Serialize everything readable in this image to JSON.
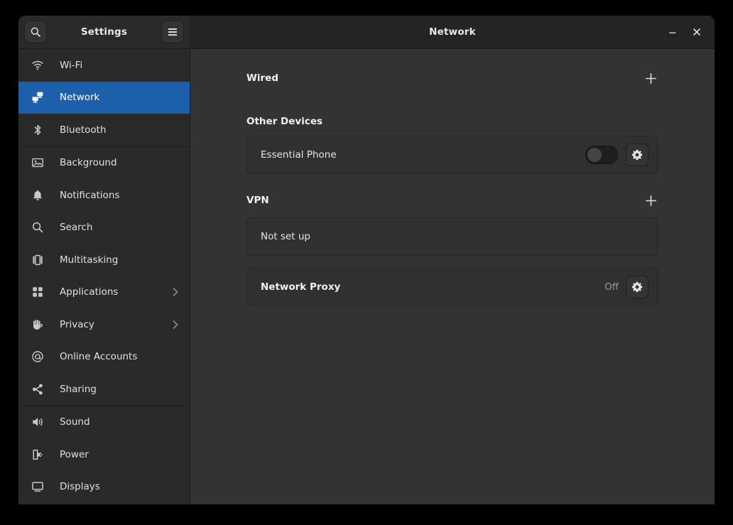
{
  "window": {
    "title": "Network",
    "minimize_label": "–",
    "close_label": "✕"
  },
  "sidebar_header": {
    "title": "Settings",
    "search_icon": "search-icon",
    "menu_icon": "hamburger-menu-icon"
  },
  "sidebar": {
    "items": [
      {
        "label": "Wi-Fi",
        "icon": "wifi-icon",
        "selected": false,
        "chevron": false
      },
      {
        "label": "Network",
        "icon": "network-icon",
        "selected": true,
        "chevron": false
      },
      {
        "label": "Bluetooth",
        "icon": "bluetooth-icon",
        "selected": false,
        "chevron": false
      },
      {
        "label": "Background",
        "icon": "background-image-icon",
        "selected": false,
        "chevron": false
      },
      {
        "label": "Notifications",
        "icon": "bell-icon",
        "selected": false,
        "chevron": false
      },
      {
        "label": "Search",
        "icon": "search-icon",
        "selected": false,
        "chevron": false
      },
      {
        "label": "Multitasking",
        "icon": "multitasking-icon",
        "selected": false,
        "chevron": false
      },
      {
        "label": "Applications",
        "icon": "applications-grid-icon",
        "selected": false,
        "chevron": true
      },
      {
        "label": "Privacy",
        "icon": "hand-privacy-icon",
        "selected": false,
        "chevron": true
      },
      {
        "label": "Online Accounts",
        "icon": "at-sign-icon",
        "selected": false,
        "chevron": false
      },
      {
        "label": "Sharing",
        "icon": "share-nodes-icon",
        "selected": false,
        "chevron": false
      },
      {
        "label": "Sound",
        "icon": "speaker-icon",
        "selected": false,
        "chevron": false
      },
      {
        "label": "Power",
        "icon": "power-plug-icon",
        "selected": false,
        "chevron": false
      },
      {
        "label": "Displays",
        "icon": "display-monitor-icon",
        "selected": false,
        "chevron": false
      }
    ],
    "separators_after": [
      2,
      10
    ],
    "selected_color": "#1c5fab"
  },
  "main": {
    "wired": {
      "title": "Wired",
      "add_label": "+"
    },
    "other_devices": {
      "title": "Other Devices",
      "device_name": "Essential Phone",
      "toggle_state": "off",
      "settings_icon": "gear-icon"
    },
    "vpn": {
      "title": "VPN",
      "add_label": "+",
      "status": "Not set up"
    },
    "network_proxy": {
      "title": "Network Proxy",
      "status": "Off",
      "settings_icon": "gear-icon"
    }
  }
}
